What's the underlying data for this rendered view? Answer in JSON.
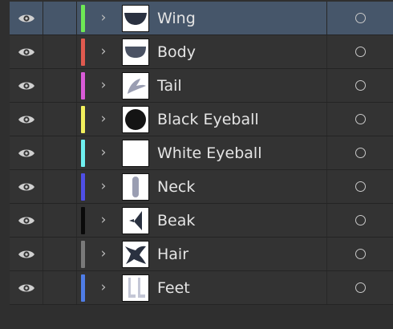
{
  "layers": [
    {
      "name": "Wing",
      "color": "#6ee855",
      "thumb_icon": "wing-thumbnail",
      "selected": true
    },
    {
      "name": "Body",
      "color": "#e05a4f",
      "thumb_icon": "body-thumbnail",
      "selected": false
    },
    {
      "name": "Tail",
      "color": "#d95bd8",
      "thumb_icon": "tail-thumbnail",
      "selected": false
    },
    {
      "name": "Black Eyeball",
      "color": "#f2f05d",
      "thumb_icon": "black-eyeball-thumbnail",
      "selected": false
    },
    {
      "name": "White Eyeball",
      "color": "#6ff0f0",
      "thumb_icon": "white-eyeball-thumbnail",
      "selected": false
    },
    {
      "name": "Neck",
      "color": "#4f4fe6",
      "thumb_icon": "neck-thumbnail",
      "selected": false
    },
    {
      "name": "Beak",
      "color": "#0a0a0a",
      "thumb_icon": "beak-thumbnail",
      "selected": false
    },
    {
      "name": "Hair",
      "color": "#7a7a7a",
      "thumb_icon": "hair-thumbnail",
      "selected": false
    },
    {
      "name": "Feet",
      "color": "#4f7de6",
      "thumb_icon": "feet-thumbnail",
      "selected": false
    }
  ],
  "colors": {
    "selected_row": "#46566a",
    "row": "#333333",
    "thumb_shape_dark": "#2a3140",
    "thumb_shape_gray": "#9a9eb2"
  }
}
